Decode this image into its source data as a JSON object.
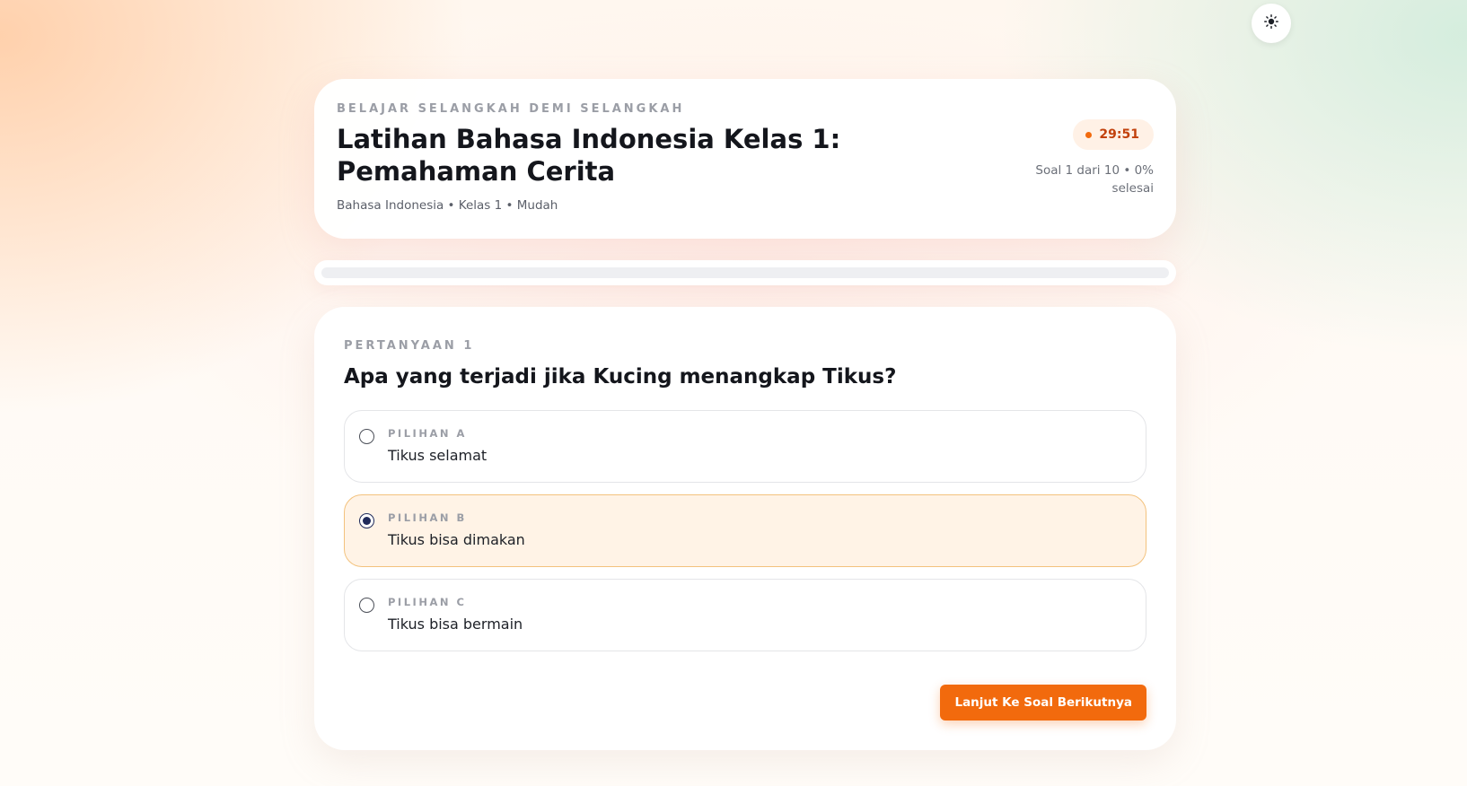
{
  "theme_toggle": {
    "icon": "sun-icon"
  },
  "header": {
    "eyebrow": "BELAJAR SELANGKAH DEMI SELANGKAH",
    "title": "Latihan Bahasa Indonesia Kelas 1: Pemahaman Cerita",
    "meta": "Bahasa Indonesia • Kelas 1 • Mudah",
    "timer": "29:51",
    "progress_text": "Soal 1 dari 10 • 0% selesai"
  },
  "progress": {
    "percent": 0
  },
  "question": {
    "label": "PERTANYAAN 1",
    "text": "Apa yang terjadi jika Kucing menangkap Tikus?",
    "options": [
      {
        "label": "PILIHAN A",
        "text": "Tikus selamat",
        "selected": false
      },
      {
        "label": "PILIHAN B",
        "text": "Tikus bisa dimakan",
        "selected": true
      },
      {
        "label": "PILIHAN C",
        "text": "Tikus bisa bermain",
        "selected": false
      }
    ]
  },
  "next_button": {
    "label": "Lanjut Ke Soal Berikutnya"
  },
  "colors": {
    "accent": "#f26a0d",
    "selected_bg": "#fff3e6",
    "selected_border": "#f3c27d"
  }
}
